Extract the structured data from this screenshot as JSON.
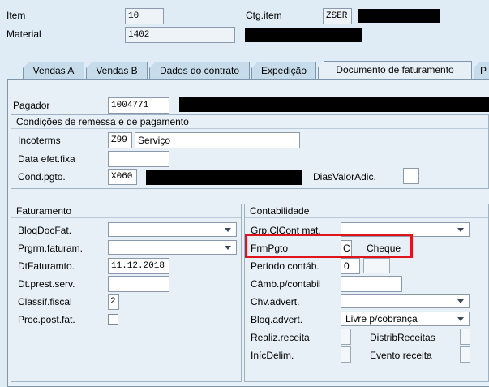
{
  "header": {
    "item_label": "Item",
    "item_value": "10",
    "material_label": "Material",
    "material_value": "1402",
    "ctg_item_label": "Ctg.item",
    "ctg_item_value": "ZSER"
  },
  "tabs": [
    {
      "label": "Vendas A"
    },
    {
      "label": "Vendas B"
    },
    {
      "label": "Dados do contrato"
    },
    {
      "label": "Expedição"
    },
    {
      "label": "Documento de faturamento"
    },
    {
      "label": "P"
    }
  ],
  "payer": {
    "label": "Pagador",
    "value": "1004771"
  },
  "delivery_payment": {
    "title": "Condições de remessa e de pagamento",
    "incoterms_label": "Incoterms",
    "incoterms_code": "Z99",
    "incoterms_text": "Serviço",
    "fixed_date_label": "Data efet.fixa",
    "fixed_date_value": "",
    "payment_terms_label": "Cond.pgto.",
    "payment_terms_value": "X060",
    "extra_days_label": "DiasValorAdic."
  },
  "billing": {
    "title": "Faturamento",
    "billing_block_label": "BloqDocFat.",
    "billing_block_value": "",
    "billing_plan_label": "Prgrm.faturam.",
    "billing_plan_value": "",
    "billing_date_label": "DtFaturamto.",
    "billing_date_value": "11.12.2018",
    "service_date_label": "Dt.prest.serv.",
    "service_date_value": "",
    "tax_class_label": "Classif.fiscal",
    "tax_class_value": "2",
    "post_billing_label": "Proc.post.fat."
  },
  "accounting": {
    "title": "Contabilidade",
    "acct_group_label": "Grp.ClCont mat.",
    "acct_group_value": "",
    "payment_method_label": "FrmPgto",
    "payment_method_code": "C",
    "payment_method_text": "Cheque",
    "period_label": "Período contáb.",
    "period_value": "0",
    "exchange_rate_label": "Câmb.p/contabil",
    "exchange_rate_value": "",
    "dunning_key_label": "Chv.advert.",
    "dunning_key_value": "",
    "dunning_block_label": "Bloq.advert.",
    "dunning_block_value": "Livre p/cobrança",
    "rev_recognition_label": "Realiz.receita",
    "rev_distribution_label": "DistribReceitas",
    "accrual_start_label": "InícDelim.",
    "rev_event_label": "Evento receita"
  },
  "colors": {
    "background": "#dfebf5",
    "highlight_box": "#e0141b"
  }
}
